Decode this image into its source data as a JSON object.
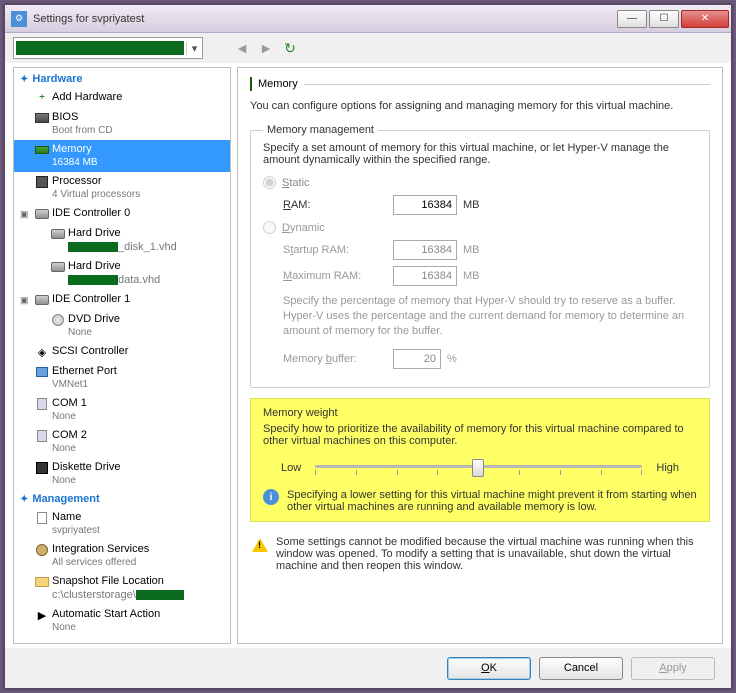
{
  "window": {
    "title": "Settings for svpriyatest"
  },
  "toolbar": {
    "nav_prev": "◄",
    "nav_next": "►",
    "refresh": "↻"
  },
  "tree": {
    "hardware": {
      "heading": "Hardware",
      "add_hardware": "Add Hardware",
      "bios": {
        "label": "BIOS",
        "sub": "Boot from CD"
      },
      "memory": {
        "label": "Memory",
        "sub": "16384 MB"
      },
      "processor": {
        "label": "Processor",
        "sub": "4 Virtual processors"
      },
      "ide0": {
        "label": "IDE Controller 0",
        "hd1": {
          "label": "Hard Drive",
          "sub_suffix": "_disk_1.vhd"
        },
        "hd2": {
          "label": "Hard Drive",
          "sub_suffix": "data.vhd"
        }
      },
      "ide1": {
        "label": "IDE Controller 1",
        "dvd": {
          "label": "DVD Drive",
          "sub": "None"
        }
      },
      "scsi": {
        "label": "SCSI Controller"
      },
      "eth": {
        "label": "Ethernet Port",
        "sub": "VMNet1"
      },
      "com1": {
        "label": "COM 1",
        "sub": "None"
      },
      "com2": {
        "label": "COM 2",
        "sub": "None"
      },
      "diskette": {
        "label": "Diskette Drive",
        "sub": "None"
      }
    },
    "management": {
      "heading": "Management",
      "name": {
        "label": "Name",
        "sub": "svpriyatest"
      },
      "integration": {
        "label": "Integration Services",
        "sub": "All services offered"
      },
      "snapshot": {
        "label": "Snapshot File Location",
        "sub_prefix": "c:\\clusterstorage\\"
      },
      "autostart": {
        "label": "Automatic Start Action",
        "sub": "None"
      }
    }
  },
  "pane": {
    "heading": "Memory",
    "description": "You can configure options for assigning and managing memory for this virtual machine.",
    "mgmt": {
      "legend": "Memory management",
      "text": "Specify a set amount of memory for this virtual machine, or let Hyper-V manage the amount dynamically within the specified range.",
      "static_label": "Static",
      "ram_label": "RAM:",
      "ram_value": "16384",
      "ram_unit": "MB",
      "dynamic_label": "Dynamic",
      "startup_label": "Startup RAM:",
      "startup_value": "16384",
      "startup_unit": "MB",
      "max_label": "Maximum RAM:",
      "max_value": "16384",
      "max_unit": "MB",
      "reserve_note": "Specify the percentage of memory that Hyper-V should try to reserve as a buffer. Hyper-V uses the percentage and the current demand for memory to determine an amount of memory for the buffer.",
      "buffer_label": "Memory buffer:",
      "buffer_value": "20",
      "buffer_unit": "%"
    },
    "weight": {
      "title": "Memory weight",
      "text": "Specify how to prioritize the availability of memory for this virtual machine compared to other virtual machines on this computer.",
      "low": "Low",
      "high": "High",
      "info": "Specifying a lower setting for this virtual machine might prevent it from starting when other virtual machines are running and available memory is low."
    },
    "warning": "Some settings cannot be modified because the virtual machine was running when this window was opened. To modify a setting that is unavailable, shut down the virtual machine and then reopen this window."
  },
  "buttons": {
    "ok": "OK",
    "cancel": "Cancel",
    "apply": "Apply"
  }
}
